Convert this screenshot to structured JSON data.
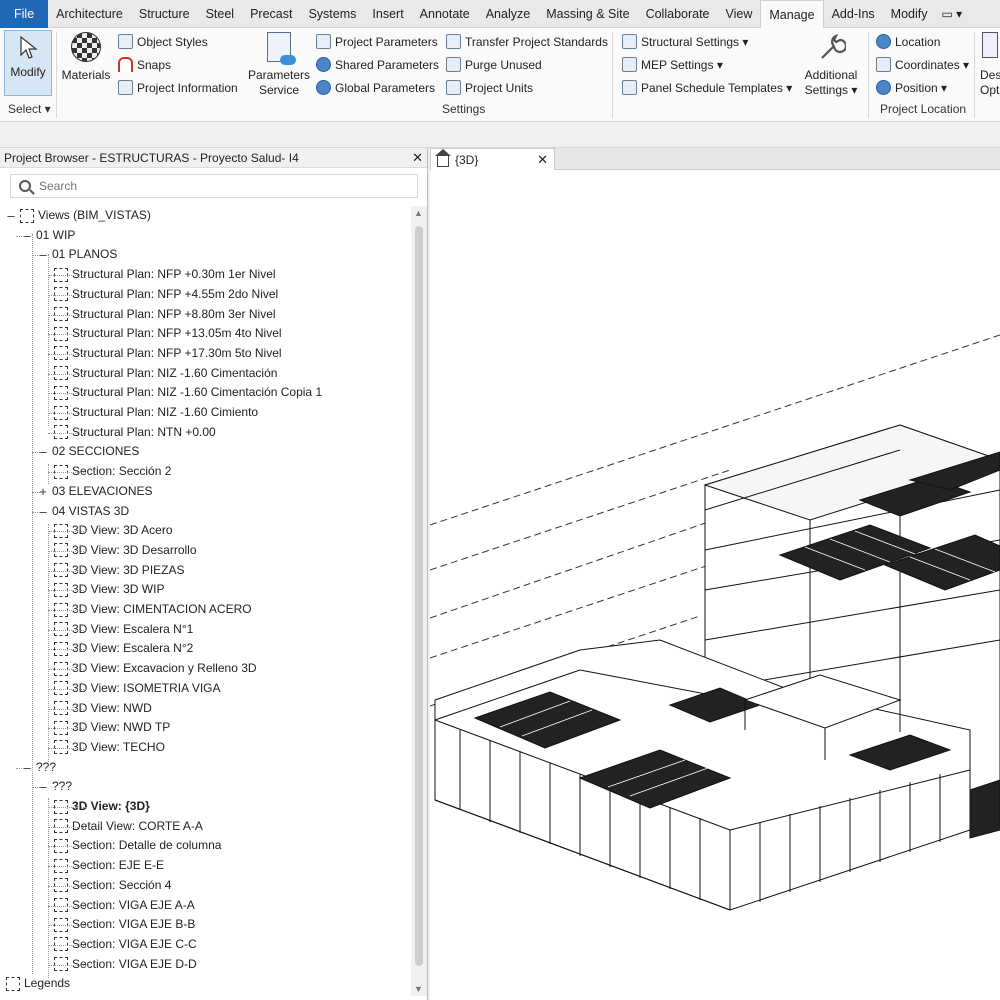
{
  "menu": {
    "file": "File",
    "tabs": [
      "Architecture",
      "Structure",
      "Steel",
      "Precast",
      "Systems",
      "Insert",
      "Annotate",
      "Analyze",
      "Massing & Site",
      "Collaborate",
      "View",
      "Manage",
      "Add-Ins",
      "Modify"
    ],
    "active": "Manage",
    "end_glyph": "▭ ▾"
  },
  "ribbon": {
    "modify": "Modify",
    "select": "Select ▾",
    "materials": "Materials",
    "object_styles": "Object Styles",
    "snaps": "Snaps",
    "project_information": "Project Information",
    "parameters_service": [
      "Parameters",
      "Service"
    ],
    "project_parameters": "Project Parameters",
    "shared_parameters": "Shared Parameters",
    "global_parameters": "Global Parameters",
    "transfer_standards": "Transfer Project Standards",
    "purge_unused": "Purge Unused",
    "project_units": "Project Units",
    "settings_label": "Settings",
    "structural_settings": "Structural Settings ▾",
    "mep_settings": "MEP Settings ▾",
    "panel_schedule": "Panel Schedule Templates ▾",
    "additional_settings": [
      "Additional",
      "Settings ▾"
    ],
    "location": "Location",
    "coordinates": "Coordinates ▾",
    "position": "Position ▾",
    "project_location_label": "Project Location",
    "design_options": [
      "Des",
      "Opt"
    ]
  },
  "browser": {
    "title": "Project Browser - ESTRUCTURAS - Proyecto Salud- I4",
    "close": "✕",
    "search_placeholder": "Search",
    "root": "Views (BIM_VISTAS)",
    "wip": "01 WIP",
    "planos": "01 PLANOS",
    "plans": [
      "Structural Plan: NFP +0.30m 1er Nivel",
      "Structural Plan: NFP +4.55m 2do Nivel",
      "Structural Plan: NFP +8.80m 3er Nivel",
      "Structural Plan: NFP +13.05m 4to Nivel",
      "Structural Plan: NFP +17.30m 5to Nivel",
      "Structural Plan: NIZ -1.60 Cimentación",
      "Structural Plan: NIZ -1.60 Cimentación Copia 1",
      "Structural Plan: NIZ -1.60 Cimiento",
      "Structural Plan: NTN +0.00"
    ],
    "secciones": "02 SECCIONES",
    "secciones_items": [
      "Section: Sección 2"
    ],
    "elevaciones": "03 ELEVACIONES",
    "vistas3d": "04 VISTAS 3D",
    "views3d": [
      "3D View: 3D Acero",
      "3D View: 3D Desarrollo",
      "3D View: 3D PIEZAS",
      "3D View: 3D WIP",
      "3D View: CIMENTACION ACERO",
      "3D View: Escalera N°1",
      "3D View: Escalera N°2",
      "3D View: Excavacion y Relleno 3D",
      "3D View: ISOMETRIA VIGA",
      "3D View: NWD",
      "3D View: NWD TP",
      "3D View: TECHO"
    ],
    "unknown1": "???",
    "unknown2": "???",
    "other_items": [
      "3D View: {3D}",
      "Detail View: CORTE A-A",
      "Section: Detalle de columna",
      "Section: EJE E-E",
      "Section: Sección 4",
      "Section: VIGA EJE A-A",
      "Section: VIGA EJE B-B",
      "Section: VIGA EJE C-C",
      "Section: VIGA EJE D-D"
    ],
    "legends": "Legends"
  },
  "view": {
    "tab_label": "{3D}",
    "tab_close": "✕"
  }
}
